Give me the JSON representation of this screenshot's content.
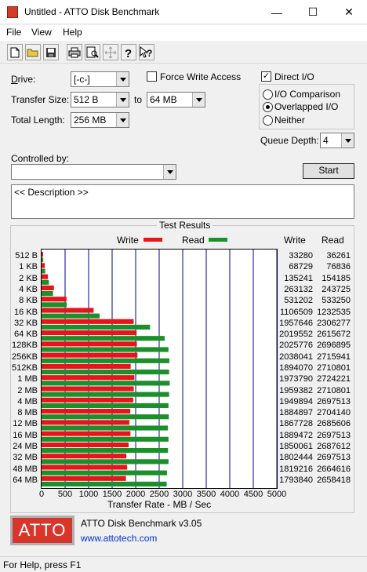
{
  "window": {
    "title": "Untitled - ATTO Disk Benchmark",
    "minimize_glyph": "—",
    "maximize_glyph": "☐",
    "close_glyph": "✕"
  },
  "menu": {
    "file": "File",
    "view": "View",
    "help": "Help"
  },
  "toolbar": {
    "icons": [
      "new-document-icon",
      "open-folder-icon",
      "save-disk-icon",
      "print-icon",
      "print-preview-icon",
      "move-icon",
      "help-question-icon",
      "context-help-icon"
    ]
  },
  "settings": {
    "drive_label": "Drive:",
    "drive_value": "[-c-]",
    "transfer_size_label": "Transfer Size:",
    "transfer_from": "512 B",
    "to_label": "to",
    "transfer_to": "64 MB",
    "total_length_label": "Total Length:",
    "total_length_value": "256 MB",
    "force_write_access": "Force Write Access",
    "force_write_checked": false,
    "direct_io": "Direct I/O",
    "direct_io_checked": true,
    "io_comparison": "I/O Comparison",
    "overlapped_io": "Overlapped I/O",
    "neither": "Neither",
    "selected_io_mode": "Overlapped I/O",
    "queue_depth_label": "Queue Depth:",
    "queue_depth_value": "4",
    "controlled_by_label": "Controlled by:",
    "controlled_by_value": "",
    "start_button": "Start",
    "description": "<< Description >>",
    "check_glyph": "✓"
  },
  "results": {
    "group_title": "Test Results",
    "write_legend": "Write",
    "read_legend": "Read",
    "write_col": "Write",
    "read_col": "Read",
    "x_axis_label": "Transfer Rate - MB / Sec",
    "write_color": "#e8141c",
    "read_color": "#1a8f2a",
    "grid_color": "#00008b"
  },
  "chart_data": {
    "type": "bar",
    "orientation": "horizontal",
    "categories": [
      "512 B",
      "1 KB",
      "2 KB",
      "4 KB",
      "8 KB",
      "16 KB",
      "32 KB",
      "64 KB",
      "128KB",
      "256KB",
      "512KB",
      "1 MB",
      "2 MB",
      "4 MB",
      "8 MB",
      "12 MB",
      "16 MB",
      "24 MB",
      "32 MB",
      "48 MB",
      "64 MB"
    ],
    "series": [
      {
        "name": "Write",
        "values": [
          33280,
          68729,
          135241,
          263132,
          531202,
          1106509,
          1957646,
          2019552,
          2025776,
          2038041,
          1894070,
          1973790,
          1959382,
          1949894,
          1884897,
          1867728,
          1889472,
          1850061,
          1802444,
          1819216,
          1793840
        ]
      },
      {
        "name": "Read",
        "values": [
          36261,
          76836,
          154185,
          243725,
          533250,
          1232535,
          2306277,
          2615672,
          2696895,
          2715941,
          2710801,
          2724221,
          2710801,
          2697513,
          2704140,
          2685606,
          2697513,
          2687612,
          2697513,
          2664616,
          2658418
        ]
      }
    ],
    "x_ticks": [
      "0",
      "500",
      "1000",
      "1500",
      "2000",
      "2500",
      "3000",
      "3500",
      "4000",
      "4500",
      "5000"
    ],
    "xlim": [
      0,
      5000
    ],
    "values_unit_divisor": 1000,
    "xlabel": "Transfer Rate - MB / Sec",
    "grid": true,
    "legend": "top"
  },
  "footer": {
    "logo_text": "ATTO",
    "product": "ATTO Disk Benchmark v3.05",
    "link": "www.attotech.com"
  },
  "status": {
    "text": "For Help, press F1"
  }
}
